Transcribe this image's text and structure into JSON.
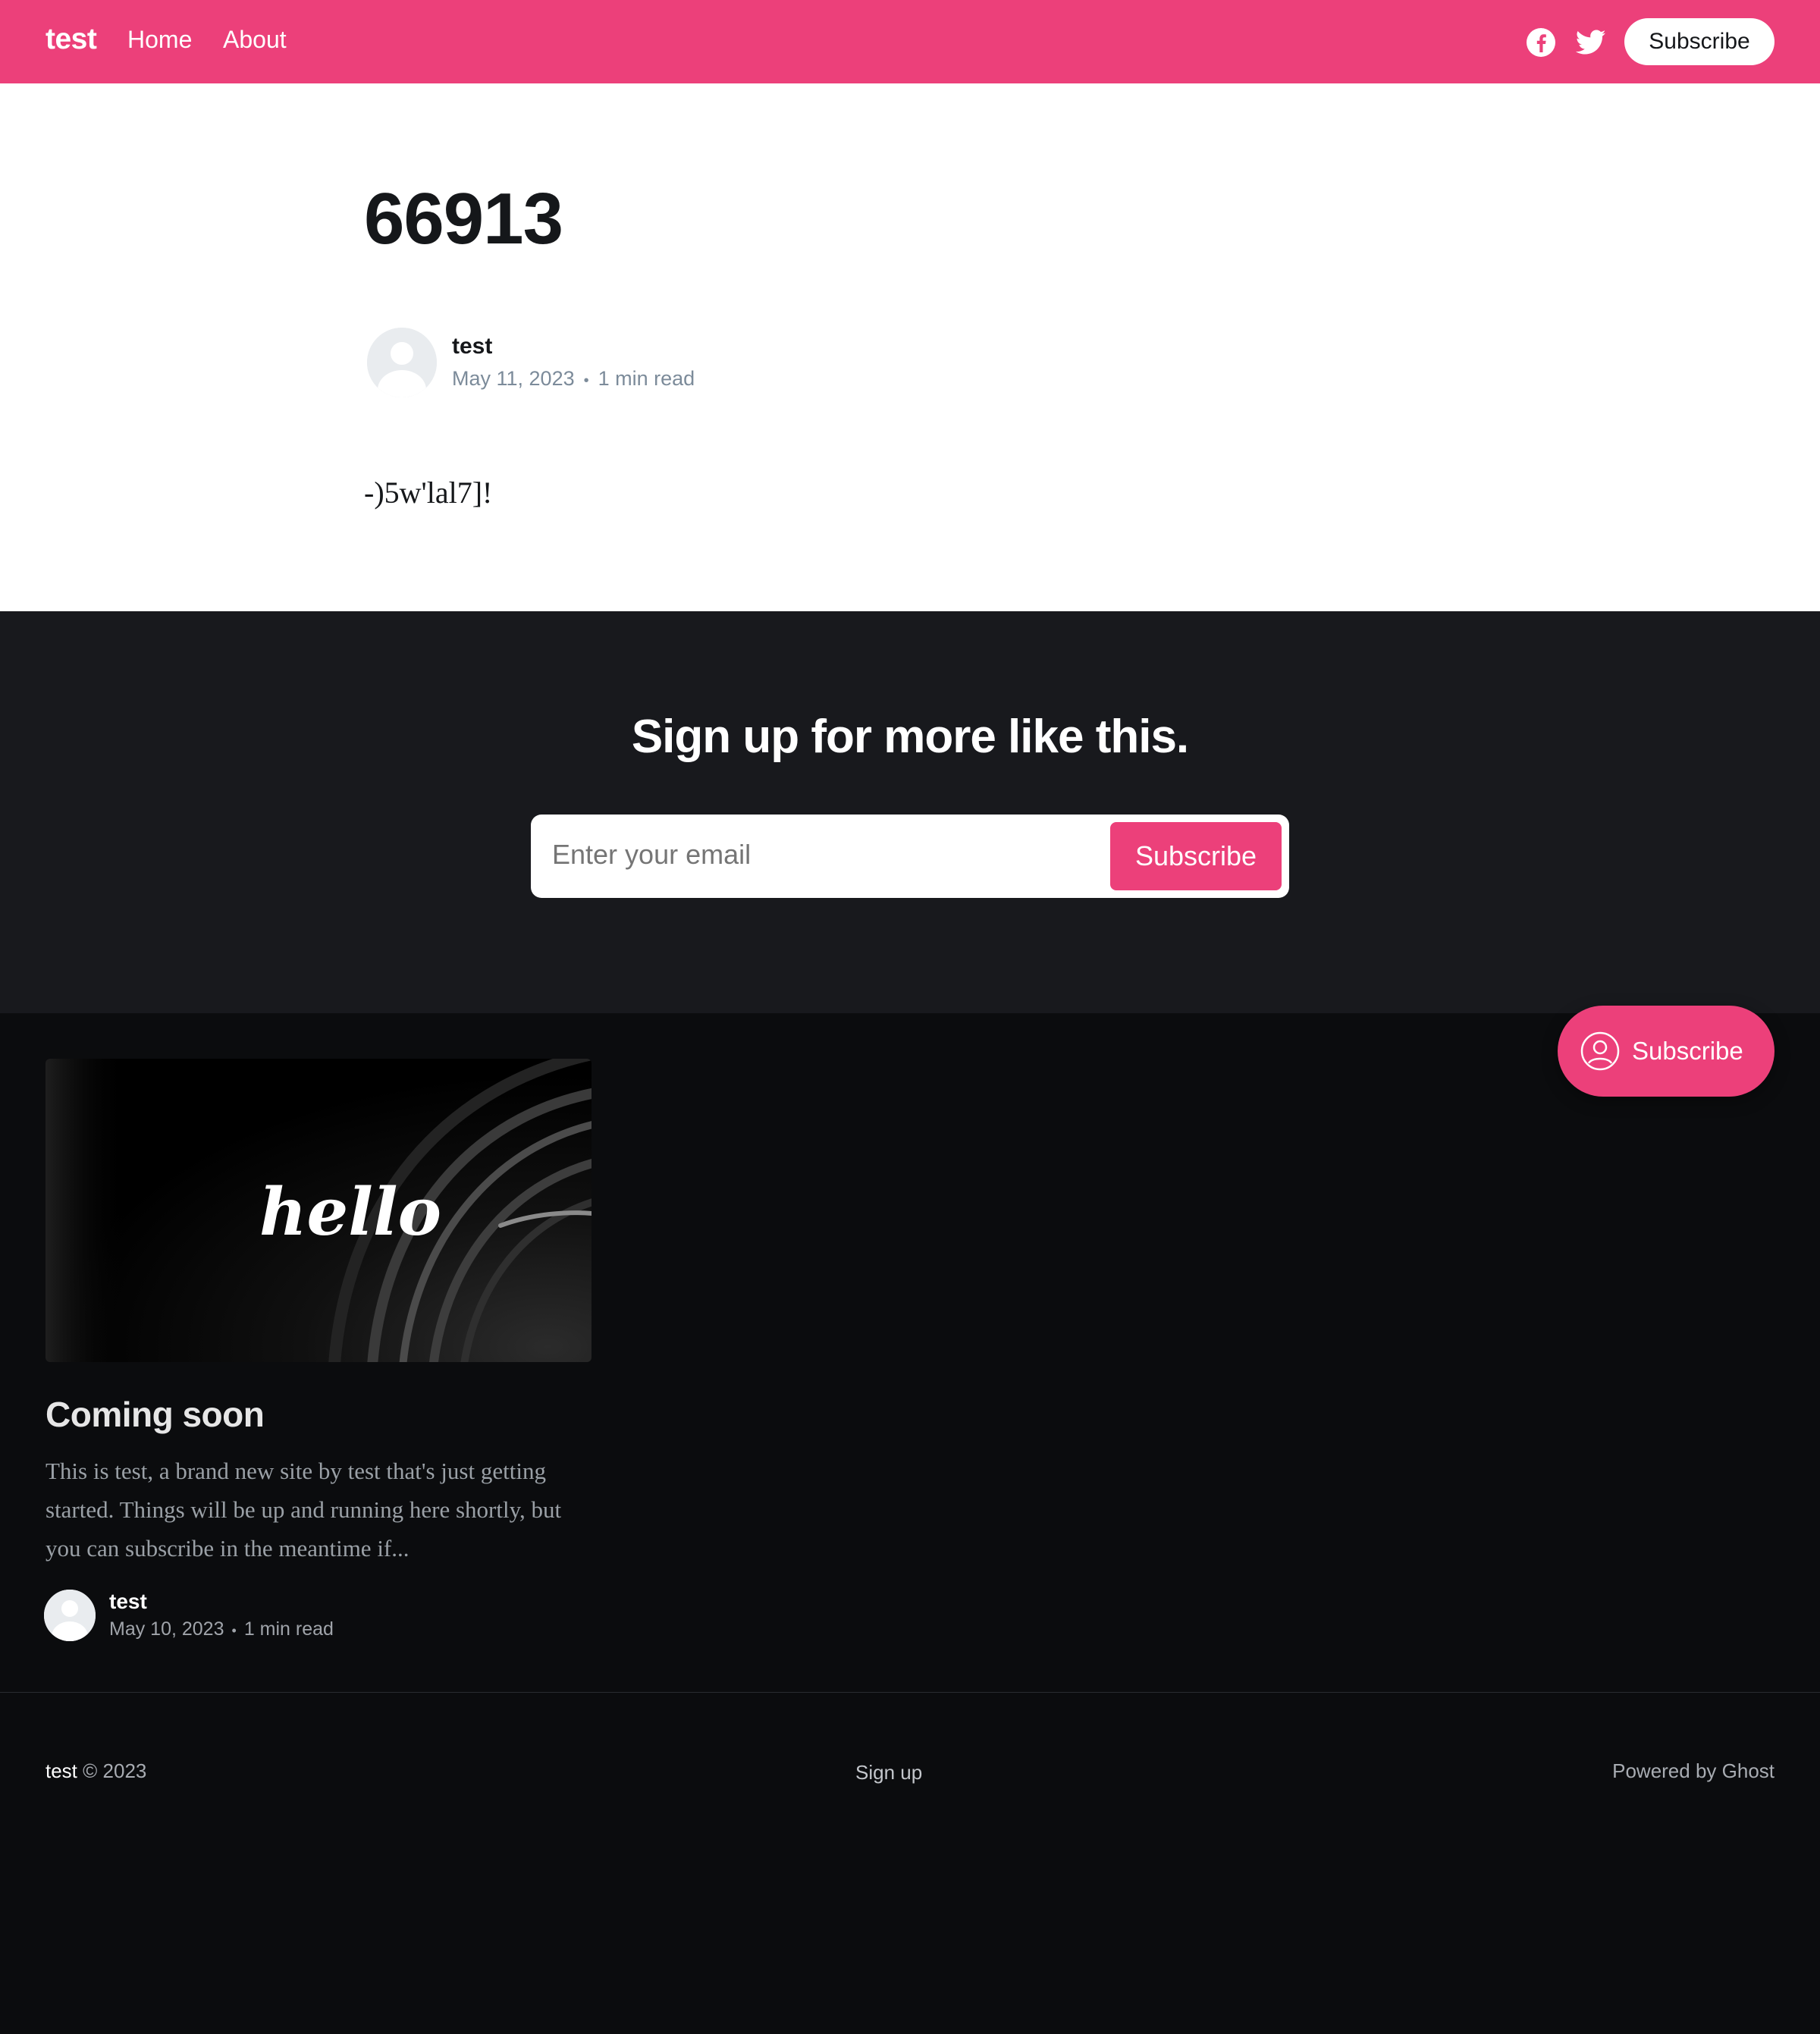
{
  "header": {
    "site_name": "test",
    "nav": [
      {
        "label": "Home"
      },
      {
        "label": "About"
      }
    ],
    "social_icons": [
      "facebook-icon",
      "twitter-icon"
    ],
    "subscribe_label": "Subscribe"
  },
  "article": {
    "title": "66913",
    "author": "test",
    "date": "May 11, 2023",
    "separator": "•",
    "read_time": "1 min read",
    "body": "-)5w'lal7]!"
  },
  "cta": {
    "title": "Sign up for more like this.",
    "email_placeholder": "Enter your email",
    "button_label": "Subscribe"
  },
  "feed": {
    "cards": [
      {
        "image_text": "hello",
        "title": "Coming soon",
        "excerpt": "This is test, a brand new site by test that's just getting started. Things will be up and running here shortly, but you can subscribe in the meantime if...",
        "author": "test",
        "date": "May 10, 2023",
        "read_time": "1 min read"
      }
    ]
  },
  "floating_subscribe": {
    "label": "Subscribe"
  },
  "footer": {
    "site_name": "test",
    "copyright": "© 2023",
    "signup": "Sign up",
    "powered_by": "Powered by Ghost"
  },
  "colors": {
    "accent": "#ec407a",
    "cta_background": "#18191d",
    "page_dark": "#0b0c0e"
  }
}
